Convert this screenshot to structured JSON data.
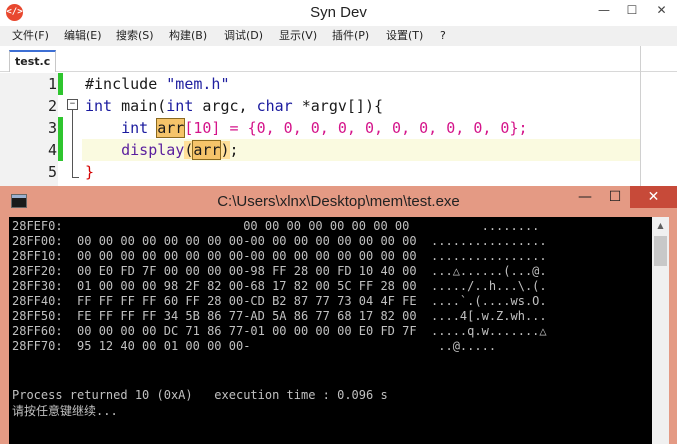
{
  "ide": {
    "title": "Syn Dev",
    "app_icon": "</>",
    "controls": {
      "minimize": "—",
      "maximize": "☐",
      "close": "✕"
    },
    "menu": [
      {
        "label": "文件(F)"
      },
      {
        "label": "编辑(E)"
      },
      {
        "label": "搜索(S)"
      },
      {
        "label": "构建(B)"
      },
      {
        "label": "调试(D)"
      },
      {
        "label": "显示(V)"
      },
      {
        "label": "插件(P)"
      },
      {
        "label": "设置(T)"
      },
      {
        "label": "?"
      }
    ],
    "active_tab": "test.c",
    "fold_marker": "−",
    "code": {
      "line_numbers": [
        "1",
        "2",
        "3",
        "4",
        "5"
      ],
      "line1": {
        "directive": "#include",
        "header": "\"mem.h\""
      },
      "line2": {
        "kw_int": "int",
        "name": "main",
        "open": "(",
        "kw_int2": "int",
        "argc": "argc",
        "comma": ", ",
        "kw_char": "char",
        "star": "*",
        "argv": "argv[]",
        "close": "){"
      },
      "line3": {
        "kw_int": "int",
        "var": "arr",
        "index": "[10]",
        "assign": " = ",
        "init": "{0, 0, 0, 0, 0, 0, 0, 0, 0, 0};"
      },
      "line4": {
        "fn": "display",
        "open": "(",
        "arg": "arr",
        "close": ")",
        "semi": ";"
      },
      "line5": {
        "brace": "}"
      }
    }
  },
  "console": {
    "title": "C:\\Users\\xlnx\\Desktop\\mem\\test.exe",
    "controls": {
      "minimize": "—",
      "maximize": "☐",
      "close": "✕"
    },
    "scroll_up": "▲",
    "lines": [
      "28FEF0:                         00 00 00 00 00 00 00 00          ........",
      "28FF00:  00 00 00 00 00 00 00 00-00 00 00 00 00 00 00 00  ................",
      "28FF10:  00 00 00 00 00 00 00 00-00 00 00 00 00 00 00 00  ................",
      "28FF20:  00 E0 FD 7F 00 00 00 00-98 FF 28 00 FD 10 40 00  ...△......(...@.",
      "28FF30:  01 00 00 00 98 2F 82 00-68 17 82 00 5C FF 28 00  ...../..h...\\.(.",
      "28FF40:  FF FF FF FF 60 FF 28 00-CD B2 87 77 73 04 4F FE  ....`.(....ws.O.",
      "28FF50:  FE FF FF FF 34 5B 86 77-AD 5A 86 77 68 17 82 00  ....4[.w.Z.wh...",
      "28FF60:  00 00 00 00 DC 71 86 77-01 00 00 00 00 E0 FD 7F  .....q.w.......△",
      "28FF70:  95 12 40 00 01 00 00 00-                          ..@.....",
      "",
      "",
      "Process returned 10 (0xA)   execution time : 0.096 s",
      "请按任意键继续..."
    ]
  }
}
